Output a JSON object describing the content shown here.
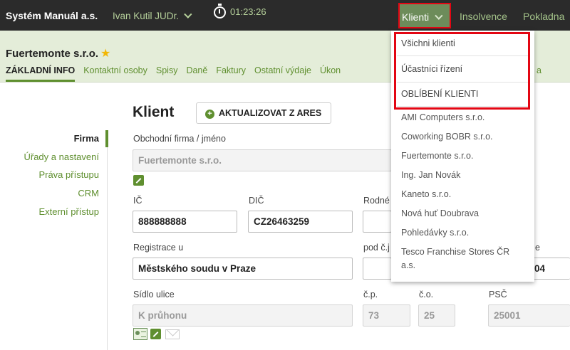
{
  "topbar": {
    "brand": "Systém Manuál a.s.",
    "user": "Ivan Kutil JUDr.",
    "timer": "01:23:26",
    "menu_active": "Klienti",
    "menu_items": [
      "Insolvence",
      "Pokladna"
    ]
  },
  "client": {
    "name": "Fuertemonte s.r.o.",
    "tabs": [
      "ZÁKLADNÍ INFO",
      "Kontaktní osoby",
      "Spisy",
      "Daně",
      "Faktury",
      "Ostatní výdaje",
      "Úkon",
      "a"
    ]
  },
  "sidenav": {
    "items": [
      "Firma",
      "Úřady a nastavení",
      "Práva přístupu",
      "CRM",
      "Externí přístup"
    ]
  },
  "form": {
    "title": "Klient",
    "ares_button": "AKTUALIZOVAT Z ARES",
    "company_label": "Obchodní firma / jméno",
    "company_value": "Fuertemonte s.r.o.",
    "ic_label": "IČ",
    "ic_value": "888888888",
    "dic_label": "DIČ",
    "dic_value": "CZ26463259",
    "rodne_label": "Rodné",
    "registrace_label": "Registrace u",
    "registrace_value": "Městského soudu v Praze",
    "pod_cj_label": "pod č.j",
    "e_label": "e",
    "e_value_partial": "04",
    "sidlo_label": "Sídlo ulice",
    "sidlo_value": "K průhonu",
    "cp_label": "č.p.",
    "cp_value": "73",
    "co_label": "č.o.",
    "co_value": "25",
    "psc_label": "PSČ",
    "psc_value": "25001"
  },
  "dropdown": {
    "items": [
      "Všichni klienti",
      "Účastníci řízení",
      "OBLÍBENÍ KLIENTI"
    ],
    "clients": [
      "AMI Computers s.r.o.",
      "Coworking BOBR s.r.o.",
      "Fuertemonte s.r.o.",
      "Ing. Jan Novák",
      "Kaneto s.r.o.",
      "Nová huť Doubrava",
      "Pohledávky s.r.o.",
      "Tesco Franchise Stores ČR",
      "a.s."
    ]
  },
  "colors": {
    "topbar_bg": "#2b2b2b",
    "accent_green": "#5f8f2f",
    "header_bg": "#e4edd9",
    "highlight_red": "#e30613"
  }
}
